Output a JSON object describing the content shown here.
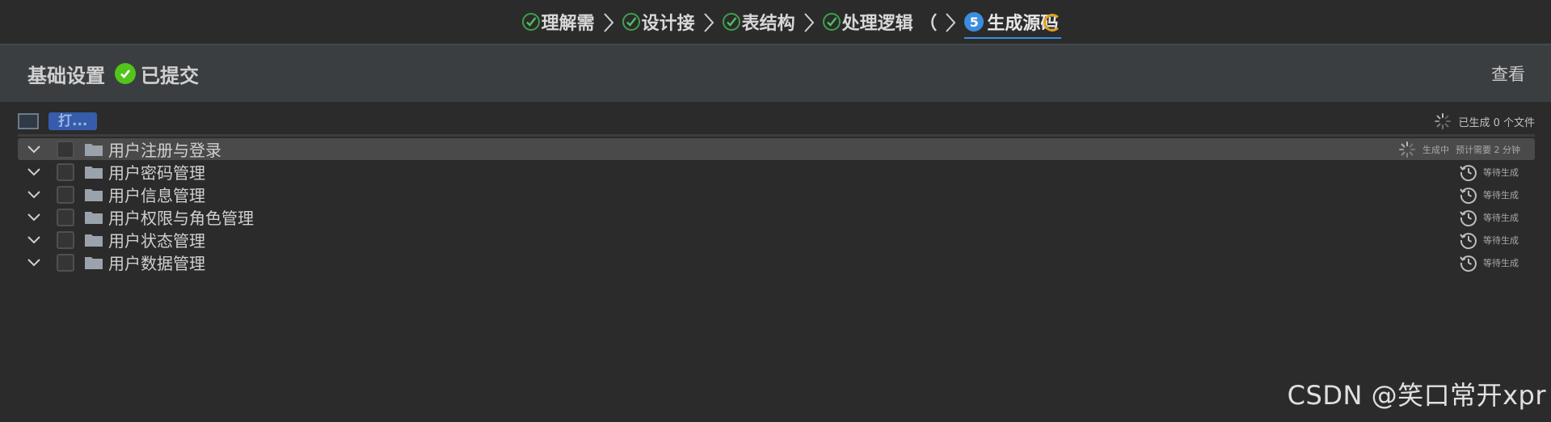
{
  "stepper": {
    "steps": [
      {
        "label": "理解需",
        "state": "done"
      },
      {
        "label": "设计接",
        "state": "done"
      },
      {
        "label": "表结构",
        "state": "done"
      },
      {
        "label": "处理逻辑 （",
        "state": "done"
      },
      {
        "label": "生成源码",
        "state": "active",
        "number": "5"
      }
    ]
  },
  "header": {
    "title": "基础设置",
    "status": "已提交",
    "view_label": "查看"
  },
  "toolbar": {
    "open_label": "打...",
    "generated_summary": "已生成 0 个文件"
  },
  "modules": [
    {
      "label": "用户注册与登录",
      "status": "生成中",
      "status_extra": "预计需要 2 分钟",
      "state": "generating"
    },
    {
      "label": "用户密码管理",
      "status": "等待生成",
      "state": "waiting"
    },
    {
      "label": "用户信息管理",
      "status": "等待生成",
      "state": "waiting"
    },
    {
      "label": "用户权限与角色管理",
      "status": "等待生成",
      "state": "waiting"
    },
    {
      "label": "用户状态管理",
      "status": "等待生成",
      "state": "waiting"
    },
    {
      "label": "用户数据管理",
      "status": "等待生成",
      "state": "waiting"
    }
  ],
  "watermark": "CSDN @笑口常开xpr",
  "colors": {
    "accent": "#3b8de0",
    "success": "#52c41a",
    "button": "#365cab",
    "background": "#2b2b2b"
  }
}
